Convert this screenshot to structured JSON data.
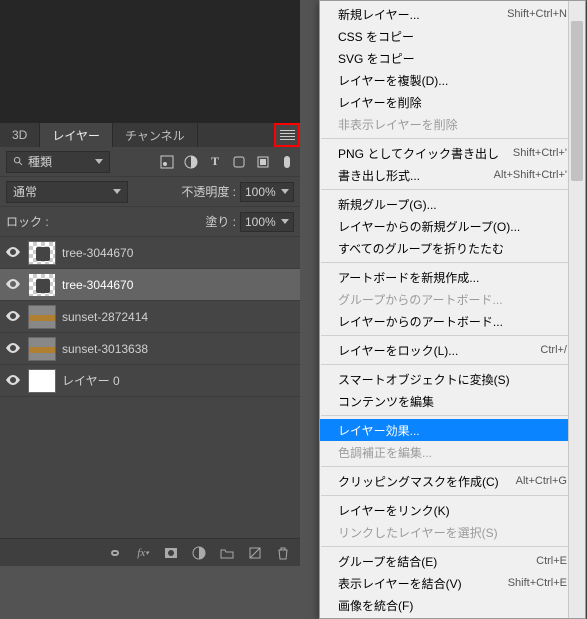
{
  "colors": {
    "accent": "#0a84ff"
  },
  "panel": {
    "tabs": {
      "t3d": "3D",
      "layers": "レイヤー",
      "channels": "チャンネル"
    },
    "search": {
      "placeholder": "種類"
    },
    "blend": {
      "mode": "通常",
      "opacity_label": "不透明度 :",
      "opacity_value": "100%"
    },
    "lock": {
      "label": "ロック :",
      "fill_label": "塗り :",
      "fill_value": "100%"
    }
  },
  "layers": [
    {
      "name": "tree-3044670",
      "kind": "checker"
    },
    {
      "name": "tree-3044670",
      "kind": "checker",
      "selected": true
    },
    {
      "name": "sunset-2872414",
      "kind": "stripe"
    },
    {
      "name": "sunset-3013638",
      "kind": "stripe"
    },
    {
      "name": "レイヤー 0",
      "kind": "white"
    }
  ],
  "menu": [
    {
      "label": "新規レイヤー...",
      "shortcut": "Shift+Ctrl+N"
    },
    {
      "label": "CSS をコピー"
    },
    {
      "label": "SVG をコピー"
    },
    {
      "label": "レイヤーを複製(D)..."
    },
    {
      "label": "レイヤーを削除"
    },
    {
      "label": "非表示レイヤーを削除",
      "disabled": true
    },
    {
      "sep": true
    },
    {
      "label": "PNG としてクイック書き出し",
      "shortcut": "Shift+Ctrl+'"
    },
    {
      "label": "書き出し形式...",
      "shortcut": "Alt+Shift+Ctrl+'"
    },
    {
      "sep": true
    },
    {
      "label": "新規グループ(G)..."
    },
    {
      "label": "レイヤーからの新規グループ(O)..."
    },
    {
      "label": "すべてのグループを折りたたむ"
    },
    {
      "sep": true
    },
    {
      "label": "アートボードを新規作成..."
    },
    {
      "label": "グループからのアートボード...",
      "disabled": true
    },
    {
      "label": "レイヤーからのアートボード..."
    },
    {
      "sep": true
    },
    {
      "label": "レイヤーをロック(L)...",
      "shortcut": "Ctrl+/"
    },
    {
      "sep": true
    },
    {
      "label": "スマートオブジェクトに変換(S)"
    },
    {
      "label": "コンテンツを編集"
    },
    {
      "sep": true
    },
    {
      "label": "レイヤー効果...",
      "highlight": true
    },
    {
      "label": "色調補正を編集...",
      "disabled": true
    },
    {
      "sep": true
    },
    {
      "label": "クリッピングマスクを作成(C)",
      "shortcut": "Alt+Ctrl+G"
    },
    {
      "sep": true
    },
    {
      "label": "レイヤーをリンク(K)"
    },
    {
      "label": "リンクしたレイヤーを選択(S)",
      "disabled": true
    },
    {
      "sep": true
    },
    {
      "label": "グループを結合(E)",
      "shortcut": "Ctrl+E"
    },
    {
      "label": "表示レイヤーを結合(V)",
      "shortcut": "Shift+Ctrl+E"
    },
    {
      "label": "画像を統合(F)"
    }
  ]
}
